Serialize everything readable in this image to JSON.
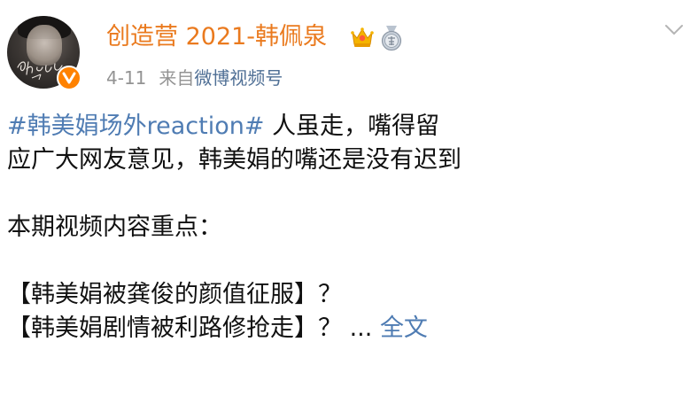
{
  "post": {
    "author": {
      "name": "创造营 2021-韩佩泉",
      "avatar_icon": "avatar-photo",
      "verified_icon": "verified-v-icon",
      "badges": [
        "crown-icon",
        "medal-icon"
      ]
    },
    "meta": {
      "date": "4-11",
      "source_prefix": "来自",
      "source": "微博视频号"
    },
    "menu_icon": "chevron-down-icon",
    "content": {
      "topic": "#韩美娟场外reaction#",
      "line1_rest": " 人虽走，嘴得留",
      "line2": "应广大网友意见，韩美娟的嘴还是没有迟到",
      "line3": "本期视频内容重点：",
      "line4": "【韩美娟被龚俊的颜值征服】？",
      "line5": "【韩美娟剧情被利路修抢走】？ ...",
      "more_link": "全文"
    }
  },
  "colors": {
    "name": "#ea7a1e",
    "link": "#4f7cb3",
    "meta": "#939393",
    "verified": "#ff8200"
  }
}
